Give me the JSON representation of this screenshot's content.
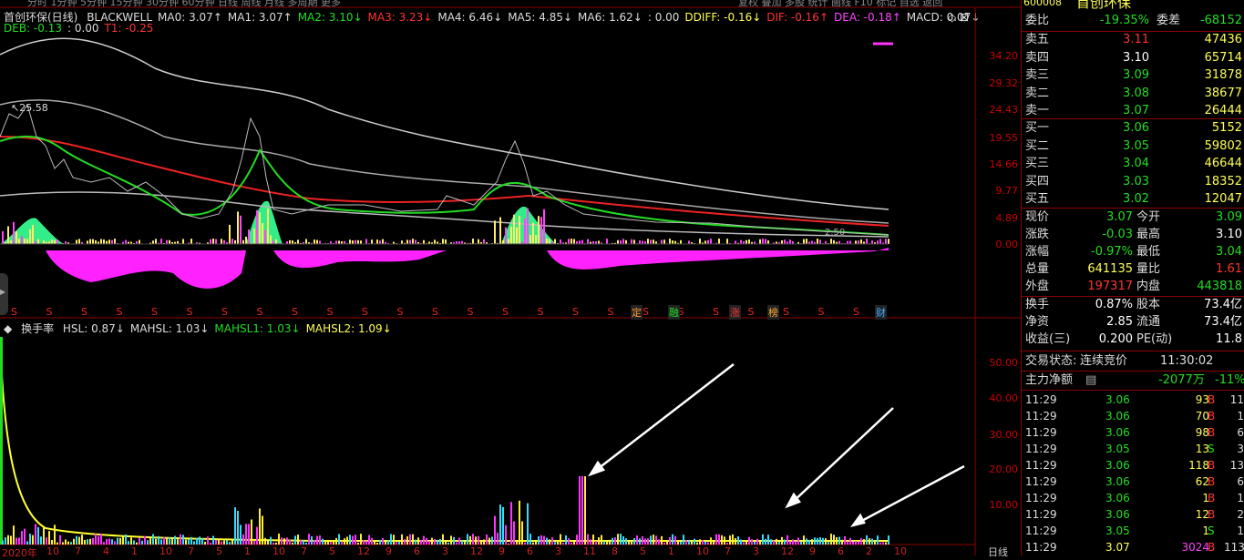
{
  "top_menu": {
    "items": [
      "分时",
      "1分钟",
      "5分钟",
      "15分钟",
      "30分钟",
      "60分钟",
      "日线",
      "周线",
      "月线",
      "多周期",
      "更多"
    ],
    "right_items": [
      "复权",
      "叠加",
      "多股",
      "统计",
      "画线",
      "F10",
      "标记",
      "自选",
      "返回"
    ]
  },
  "main_chart": {
    "title": "首创环保(日线)",
    "legend": [
      {
        "text": "BLACKWELL",
        "color": "#dddddd"
      },
      {
        "text": "MA0: 3.07↑",
        "color": "#dddddd"
      },
      {
        "text": "MA1: 3.07↑",
        "color": "#dddddd"
      },
      {
        "text": "MA2: 3.10↓",
        "color": "#22dd22"
      },
      {
        "text": "MA3: 3.23↓",
        "color": "#ff3333"
      },
      {
        "text": "MA4: 6.46↓",
        "color": "#dddddd"
      },
      {
        "text": "MA5: 4.85↓",
        "color": "#dddddd"
      },
      {
        "text": "MA6: 1.62↓",
        "color": "#dddddd"
      },
      {
        "text": ": 0.00",
        "color": "#dddddd"
      },
      {
        "text": "DDIFF: -0.16↓",
        "color": "#ffff55"
      },
      {
        "text": "DIF: -0.16↑",
        "color": "#ff3333"
      },
      {
        "text": "DEA: -0.18↑",
        "color": "#ff44ff"
      },
      {
        "text": "MACD: 0.07↓",
        "color": "#dddddd"
      }
    ],
    "legend2": [
      {
        "text": "DEB: -0.13",
        "color": "#22dd22"
      },
      {
        "text": ": 0.00",
        "color": "#dddddd"
      },
      {
        "text": "T1: -0.25",
        "color": "#ff3333"
      }
    ],
    "y_ticks": [
      "34.20",
      "29.32",
      "24.43",
      "19.55",
      "14.66",
      "9.77",
      "4.89",
      "0.00"
    ],
    "peak_label": "25.58",
    "low_label": "2.50",
    "markers": [
      "S",
      "S",
      "S",
      "S",
      "S",
      "S",
      "S",
      "S",
      "S",
      "S",
      "S",
      "S",
      "S",
      "S",
      "S",
      "S",
      "S",
      "S",
      "S",
      "S",
      "S",
      "S",
      "S",
      "S",
      "S"
    ],
    "event_tags": [
      {
        "text": "定",
        "color": "#ff9933"
      },
      {
        "text": "融",
        "color": "#22dd22"
      },
      {
        "text": "涨",
        "color": "#ff3333"
      },
      {
        "text": "榜",
        "color": "#ffaa33"
      },
      {
        "text": "财",
        "color": "#44aaff"
      }
    ]
  },
  "sub_chart": {
    "title": "换手率",
    "legend": [
      {
        "text": "HSL: 0.87↓",
        "color": "#dddddd"
      },
      {
        "text": "MAHSL: 1.03↓",
        "color": "#dddddd"
      },
      {
        "text": "MAHSL1: 1.03↓",
        "color": "#22dd22"
      },
      {
        "text": "MAHSL2: 1.09↓",
        "color": "#ffff55"
      }
    ],
    "y_ticks": [
      "50.00",
      "40.00",
      "30.00",
      "20.00",
      "10.00"
    ]
  },
  "x_axis": {
    "labels": [
      "2020年",
      "10",
      "7",
      "4",
      "1",
      "10",
      "7",
      "5",
      "1",
      "10",
      "7",
      "5",
      "12",
      "9",
      "6",
      "3",
      "12",
      "9",
      "6",
      "3",
      "11",
      "8",
      "5",
      "1",
      "10",
      "7",
      "3",
      "12",
      "9",
      "6",
      "2",
      "10"
    ],
    "period": "日线"
  },
  "panel": {
    "code": "600008",
    "name": "首创环保",
    "wei_bi_label": "委比",
    "wei_bi": "-19.35%",
    "wei_cha_label": "委差",
    "wei_cha": "-68152",
    "sell": [
      {
        "label": "卖五",
        "price": "3.11",
        "vol": "47436",
        "color": "#ff3333"
      },
      {
        "label": "卖四",
        "price": "3.10",
        "vol": "65714",
        "color": "#ffffff"
      },
      {
        "label": "卖三",
        "price": "3.09",
        "vol": "31878",
        "color": "#22dd22"
      },
      {
        "label": "卖二",
        "price": "3.08",
        "vol": "38677",
        "color": "#22dd22"
      },
      {
        "label": "卖一",
        "price": "3.07",
        "vol": "26444",
        "color": "#22dd22"
      }
    ],
    "buy": [
      {
        "label": "买一",
        "price": "3.06",
        "vol": "5152",
        "color": "#22dd22"
      },
      {
        "label": "买二",
        "price": "3.05",
        "vol": "59802",
        "color": "#22dd22"
      },
      {
        "label": "买三",
        "price": "3.04",
        "vol": "46644",
        "color": "#22dd22"
      },
      {
        "label": "买四",
        "price": "3.03",
        "vol": "18352",
        "color": "#22dd22"
      },
      {
        "label": "买五",
        "price": "3.02",
        "vol": "12047",
        "color": "#22dd22"
      }
    ],
    "quote": [
      {
        "l1": "现价",
        "v1": "3.07",
        "c1": "#22dd22",
        "l2": "今开",
        "v2": "3.09",
        "c2": "#22dd22"
      },
      {
        "l1": "涨跌",
        "v1": "-0.03",
        "c1": "#22dd22",
        "l2": "最高",
        "v2": "3.10",
        "c2": "#ffffff"
      },
      {
        "l1": "涨幅",
        "v1": "-0.97%",
        "c1": "#22dd22",
        "l2": "最低",
        "v2": "3.04",
        "c2": "#22dd22"
      },
      {
        "l1": "总量",
        "v1": "641135",
        "c1": "#ffff55",
        "l2": "量比",
        "v2": "1.61",
        "c2": "#ff3333"
      },
      {
        "l1": "外盘",
        "v1": "197317",
        "c1": "#ff3333",
        "l2": "内盘",
        "v2": "443818",
        "c2": "#22dd22"
      }
    ],
    "stats": [
      {
        "l1": "换手",
        "v1": "0.87%",
        "l2": "股本",
        "v2": "73.4亿"
      },
      {
        "l1": "净资",
        "v1": "2.85",
        "l2": "流通",
        "v2": "73.4亿"
      },
      {
        "l1": "收益(三)",
        "v1": "0.200",
        "l2": "PE(动)",
        "v2": "11.8"
      }
    ],
    "trade_status_label": "交易状态:",
    "trade_status": "连续竞价",
    "trade_time": "11:30:02",
    "net_label": "主力净额",
    "net_value": "-2077万",
    "net_pct": "-11%",
    "ticks": [
      {
        "t": "11:29",
        "p": "3.06",
        "v": "93",
        "s": "B",
        "n": "11"
      },
      {
        "t": "11:29",
        "p": "3.06",
        "v": "70",
        "s": "B",
        "n": "1"
      },
      {
        "t": "11:29",
        "p": "3.06",
        "v": "98",
        "s": "B",
        "n": "6"
      },
      {
        "t": "11:29",
        "p": "3.05",
        "v": "13",
        "s": "S",
        "n": "3"
      },
      {
        "t": "11:29",
        "p": "3.06",
        "v": "118",
        "s": "B",
        "n": "13"
      },
      {
        "t": "11:29",
        "p": "3.06",
        "v": "62",
        "s": "B",
        "n": "6"
      },
      {
        "t": "11:29",
        "p": "3.06",
        "v": "1",
        "s": "B",
        "n": "1"
      },
      {
        "t": "11:29",
        "p": "3.06",
        "v": "12",
        "s": "B",
        "n": "2"
      },
      {
        "t": "11:29",
        "p": "3.05",
        "v": "1",
        "s": "S",
        "n": "1"
      },
      {
        "t": "11:29",
        "p": "3.07",
        "v": "3024",
        "s": "B",
        "n": "113"
      }
    ]
  }
}
